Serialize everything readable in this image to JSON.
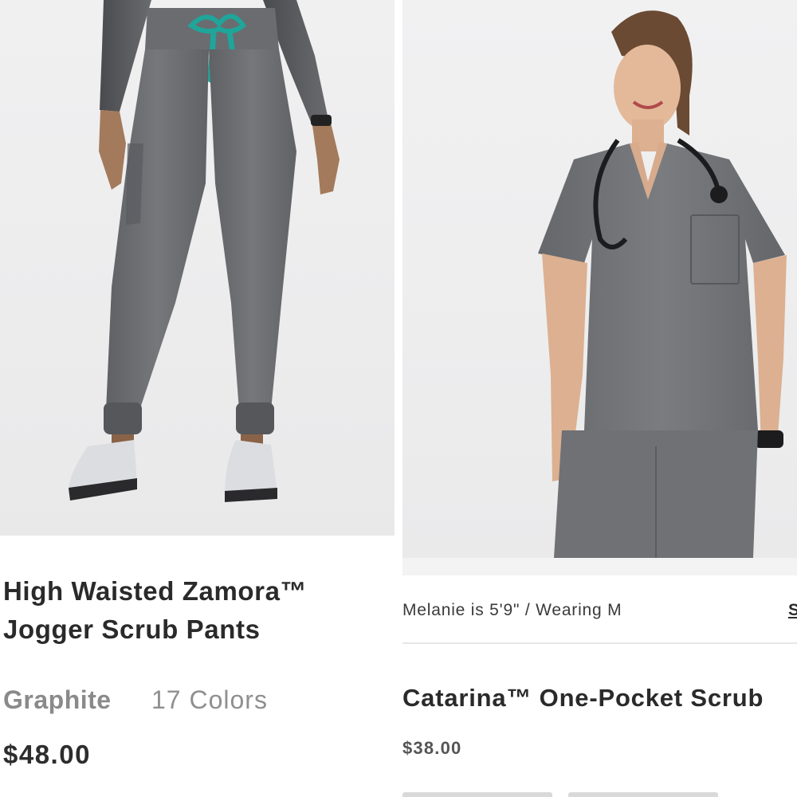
{
  "products": [
    {
      "name": "High Waisted Zamora™\nJogger Scrub Pants",
      "color_name": "Graphite",
      "colors_count": "17 Colors",
      "price": "$48.00"
    },
    {
      "model_info": "Melanie is 5'9\" / Wearing M",
      "size_link": "S",
      "name": "Catarina™ One-Pocket Scrub",
      "price": "$38.00"
    }
  ],
  "colors": {
    "fabric": "#6d6f73",
    "drawstring": "#1fa59a",
    "background": "#ededee",
    "title_text": "#2a2a2a",
    "muted_text": "#8a8a8a"
  },
  "icons": {
    "stethoscope": "stethoscope-icon",
    "watch": "watch-icon"
  }
}
